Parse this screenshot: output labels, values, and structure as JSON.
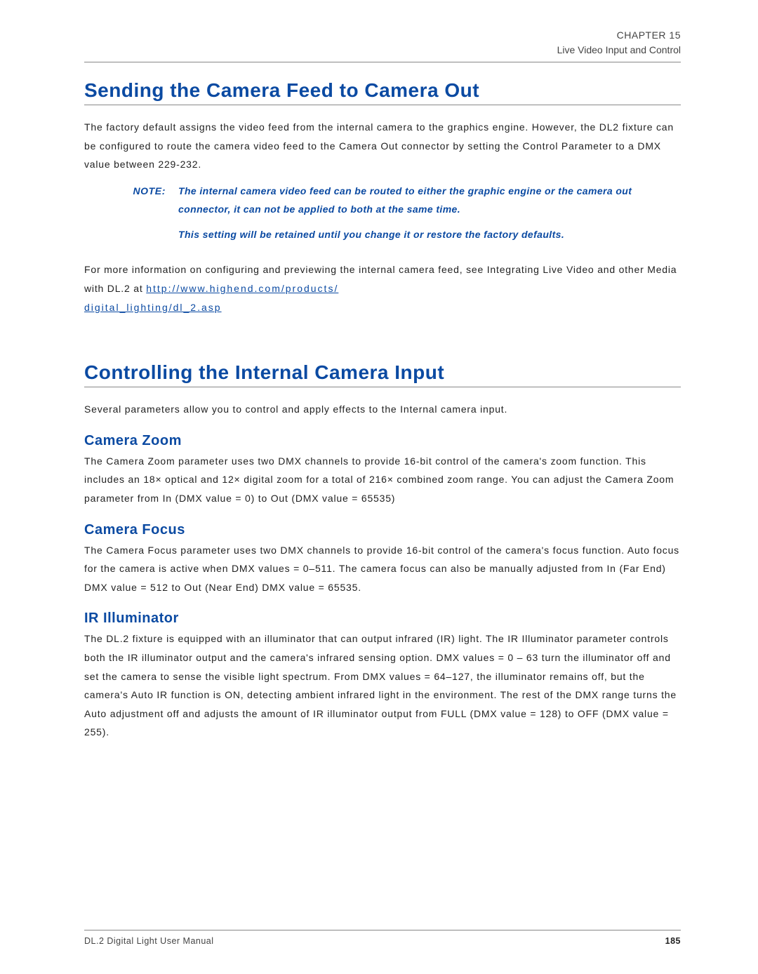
{
  "header": {
    "chapter": "CHAPTER 15",
    "title": "Live Video Input and Control"
  },
  "section1": {
    "heading": "Sending the Camera Feed to Camera Out",
    "p1": "The factory default assigns the video feed from the internal camera to the graphics engine. However, the DL2 fixture can be configured to route the camera video feed to the Camera Out connector by setting the Control Parameter to a DMX value between 229-232.",
    "note_label": "NOTE:",
    "note1": "The internal camera video feed can be routed to either the graphic engine or the camera out connector, it can not be applied to both at the same time.",
    "note2": "This setting will be retained until you change it or restore the factory defaults.",
    "p2_pre": "For more information on configuring and previewing the internal camera feed, see Integrating Live Video and other Media with DL.2 at ",
    "link1": "http://www.highend.com/products/",
    "link2": "digital_lighting/dl_2.asp"
  },
  "section2": {
    "heading": "Controlling the Internal Camera Input",
    "p1": "Several parameters allow you to control and apply effects to the Internal camera input.",
    "sub1": {
      "heading": "Camera Zoom",
      "p": "The Camera Zoom parameter uses two DMX channels to provide 16-bit control of the camera's zoom function. This includes an 18× optical and 12× digital zoom for a total of 216× combined zoom range. You can adjust the Camera Zoom parameter from In (DMX value = 0) to Out (DMX value = 65535)"
    },
    "sub2": {
      "heading": "Camera Focus",
      "p": "The Camera Focus parameter uses two DMX channels to provide 16-bit control of the camera's focus function. Auto focus for the camera is active when DMX values = 0–511. The camera focus can also be manually adjusted from In (Far End) DMX value = 512 to Out (Near End) DMX value = 65535."
    },
    "sub3": {
      "heading": "IR Illuminator",
      "p": "The DL.2 fixture is equipped with an illuminator that can output infrared (IR) light. The IR Illuminator parameter controls both the IR illuminator output and the camera's infrared sensing option. DMX values = 0 – 63 turn the illuminator off and set the camera to sense the visible light spectrum. From DMX values = 64–127, the illuminator remains off, but the camera's Auto IR function is ON, detecting ambient infrared light in the environment. The rest of the DMX range turns the Auto adjustment off and adjusts the amount of IR illuminator output from FULL (DMX value = 128) to OFF (DMX value = 255)."
    }
  },
  "footer": {
    "manual": "DL.2 Digital Light User Manual",
    "page": "185"
  }
}
